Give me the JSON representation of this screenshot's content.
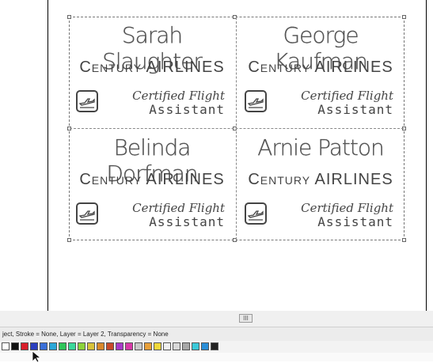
{
  "cards": [
    {
      "name": "Sarah Slaughter",
      "company": "Century AIRLINES",
      "title_line1": "Certified Flight",
      "title_line2": "Assistant"
    },
    {
      "name": "George Kaufman",
      "company": "Century AIRLINES",
      "title_line1": "Certified Flight",
      "title_line2": "Assistant"
    },
    {
      "name": "Belinda Dorfman",
      "company": "Century AIRLINES",
      "title_line1": "Certified Flight",
      "title_line2": "Assistant"
    },
    {
      "name": "Arnie Patton",
      "company": "Century AIRLINES",
      "title_line1": "Certified Flight",
      "title_line2": "Assistant"
    }
  ],
  "icons": {
    "card_icon": "airplane-takeoff-icon",
    "scroll_thumb": "grip-icon",
    "cursor": "mouse-pointer-icon"
  },
  "scrollbar": {
    "thumb_label": "III"
  },
  "status": {
    "text": "ject, Stroke = None, Layer = Layer 2, Transparency = None"
  },
  "palette": {
    "swatches": [
      "#ffffff",
      "#111111",
      "#d81e2a",
      "#2a3fbf",
      "#3a6fd8",
      "#2aa7d8",
      "#2fc45a",
      "#3ad89a",
      "#8cd23a",
      "#d8c23a",
      "#d8882a",
      "#c84a2a",
      "#a83ac8",
      "#d83aa8",
      "#c8c8c8",
      "#e8a03a",
      "#f0d83a",
      "#f0f0f0",
      "#d8d8d8",
      "#a8a8a8",
      "#3ac8d8",
      "#2a8fd8",
      "#222222"
    ]
  }
}
